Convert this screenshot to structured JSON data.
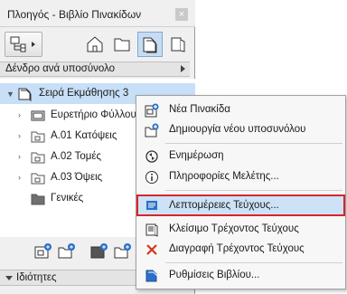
{
  "window": {
    "title": "Πλοηγός - Βιβλίο Πινακίδων",
    "close_label": "×"
  },
  "toolbar": {
    "left_button_icon": "project-tree-icon",
    "buttons": [
      {
        "icon": "project-map-icon"
      },
      {
        "icon": "view-map-icon"
      },
      {
        "icon": "layout-book-icon",
        "active": true
      },
      {
        "icon": "publisher-sets-icon"
      }
    ]
  },
  "view_selector": {
    "label": "Δένδρο ανά υποσύνολο"
  },
  "tree": {
    "items": [
      {
        "label": "Σειρά Εκμάθησης 3",
        "icon": "layout-book-icon",
        "expanded": true,
        "selected": true,
        "level": 0
      },
      {
        "label": "Ευρετήριο Φύλλου",
        "icon": "layout-icon",
        "expanded": false,
        "level": 1
      },
      {
        "label": "Α.01 Κατόψεις",
        "icon": "subset-icon",
        "expanded": false,
        "level": 1
      },
      {
        "label": "Α.02 Τομές",
        "icon": "subset-icon",
        "expanded": false,
        "level": 1
      },
      {
        "label": "Α.03 Όψεις",
        "icon": "subset-icon",
        "expanded": false,
        "level": 1
      },
      {
        "label": "Γενικές",
        "icon": "folder-icon",
        "expanded": null,
        "level": 1
      }
    ]
  },
  "bottom_toolbar": {
    "icons": [
      "new-layout-icon",
      "new-subset-icon",
      "new-master-icon",
      "new-drawing-icon",
      "settings-icon"
    ]
  },
  "properties": {
    "label": "Ιδιότητες"
  },
  "context_menu": {
    "items": [
      {
        "label": "Νέα Πινακίδα",
        "icon": "new-layout-icon"
      },
      {
        "label": "Δημιουργία νέου υποσυνόλου",
        "icon": "new-subset-icon"
      },
      {
        "label": "Ενημέρωση",
        "icon": "refresh-icon"
      },
      {
        "label": "Πληροφορίες Μελέτης...",
        "icon": "info-icon"
      },
      {
        "label": "Λεπτομέρειες Τεύχους...",
        "icon": "issue-details-icon",
        "highlighted": true
      },
      {
        "label": "Κλείσιμο Τρέχοντος Τεύχους",
        "icon": "close-issue-icon"
      },
      {
        "label": "Διαγραφή Τρέχοντος Τεύχους",
        "icon": "delete-icon"
      },
      {
        "label": "Ρυθμίσεις Βιβλίου...",
        "icon": "book-settings-icon"
      }
    ]
  },
  "colors": {
    "highlight_border": "#d4262d",
    "selection": "#c7dff7",
    "accent_blue": "#2a6fc9",
    "delete_red": "#d9341b"
  }
}
